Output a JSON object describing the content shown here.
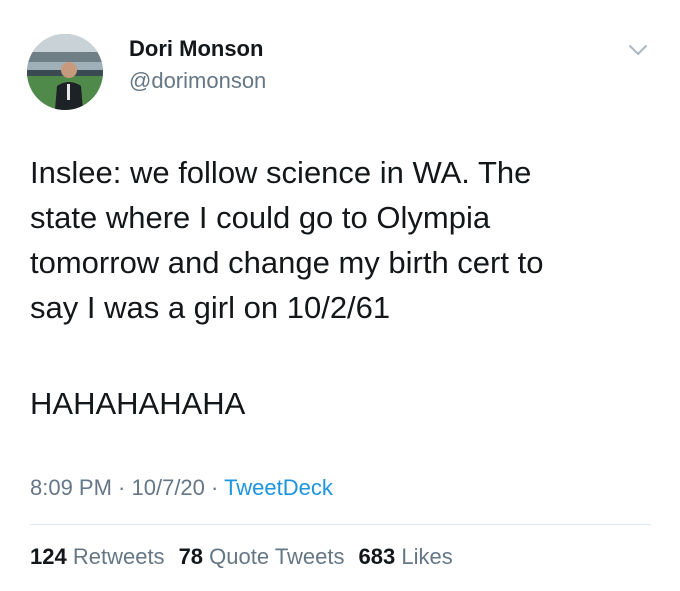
{
  "author": {
    "display_name": "Dori Monson",
    "handle": "@dorimonson",
    "avatar_icon": "profile-photo-stadium"
  },
  "menu_icon": "chevron-down-icon",
  "tweet": {
    "text": "Inslee: we follow science in WA. The\nstate where I could go to Olympia\ntomorrow and change my birth cert to\nsay I was a girl on 10/2/61",
    "text2": "HAHAHAHAHA"
  },
  "meta": {
    "time": "8:09 PM",
    "separator": " · ",
    "date": "10/7/20",
    "source": "TweetDeck"
  },
  "stats": {
    "retweets_count": "124",
    "retweets_label": "Retweets",
    "quotes_count": "78",
    "quotes_label": "Quote Tweets",
    "likes_count": "683",
    "likes_label": "Likes"
  },
  "colors": {
    "text": "#14171a",
    "secondary": "#657786",
    "link": "#1b95e0",
    "divider": "#e1e8ed"
  }
}
